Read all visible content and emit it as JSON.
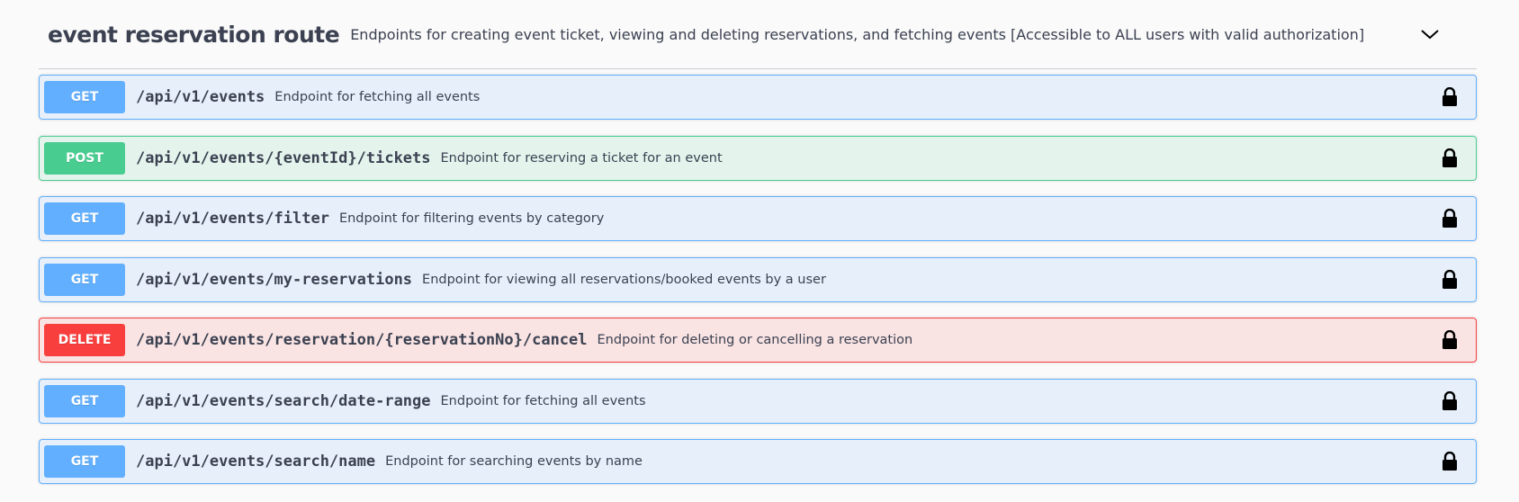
{
  "tag": {
    "name": "event reservation route",
    "description": "Endpoints for creating event ticket, viewing and deleting reservations, and fetching events [Accessible to ALL users with valid authorization]",
    "chevron_icon": "chevron-down-icon"
  },
  "operations": [
    {
      "method": "GET",
      "path": "/api/v1/events",
      "summary": "Endpoint for fetching all events"
    },
    {
      "method": "POST",
      "path": "/api/v1/events/{eventId}/tickets",
      "summary": "Endpoint for reserving a ticket for an event"
    },
    {
      "method": "GET",
      "path": "/api/v1/events/filter",
      "summary": "Endpoint for filtering events by category"
    },
    {
      "method": "GET",
      "path": "/api/v1/events/my-reservations",
      "summary": "Endpoint for viewing all reservations/booked events by a user"
    },
    {
      "method": "DELETE",
      "path": "/api/v1/events/reservation/{reservationNo}/cancel",
      "summary": "Endpoint for deleting or cancelling a reservation"
    },
    {
      "method": "GET",
      "path": "/api/v1/events/search/date-range",
      "summary": "Endpoint for fetching all events"
    },
    {
      "method": "GET",
      "path": "/api/v1/events/search/name",
      "summary": "Endpoint for searching events by name"
    }
  ],
  "colors": {
    "get": "#61affe",
    "post": "#49cc90",
    "delete": "#f93e3e",
    "text": "#3b4151"
  },
  "lock_icon": "lock-icon"
}
